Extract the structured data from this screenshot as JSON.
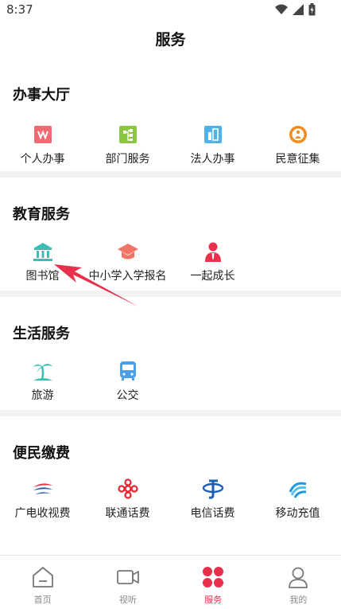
{
  "status": {
    "time": "8:37"
  },
  "page": {
    "title": "服务"
  },
  "sections": [
    {
      "title": "办事大厅",
      "items": [
        {
          "label": "个人办事",
          "icon": "person-service-icon"
        },
        {
          "label": "部门服务",
          "icon": "department-icon"
        },
        {
          "label": "法人办事",
          "icon": "legal-person-icon"
        },
        {
          "label": "民意征集",
          "icon": "public-opinion-icon"
        }
      ]
    },
    {
      "title": "教育服务",
      "items": [
        {
          "label": "图书馆",
          "icon": "library-icon"
        },
        {
          "label": "中小学入学报名",
          "icon": "graduation-cap-icon"
        },
        {
          "label": "一起成长",
          "icon": "grow-together-icon"
        }
      ]
    },
    {
      "title": "生活服务",
      "items": [
        {
          "label": "旅游",
          "icon": "palm-tree-icon"
        },
        {
          "label": "公交",
          "icon": "bus-icon"
        }
      ]
    },
    {
      "title": "便民缴费",
      "items": [
        {
          "label": "广电收视费",
          "icon": "broadcast-tv-icon"
        },
        {
          "label": "联通话费",
          "icon": "unicom-icon"
        },
        {
          "label": "电信话费",
          "icon": "telecom-icon"
        },
        {
          "label": "移动充值",
          "icon": "mobile-icon"
        }
      ]
    }
  ],
  "tabbar": [
    {
      "label": "首页",
      "icon": "home-icon",
      "active": false
    },
    {
      "label": "视听",
      "icon": "video-icon",
      "active": false
    },
    {
      "label": "服务",
      "icon": "services-grid-icon",
      "active": true
    },
    {
      "label": "我的",
      "icon": "profile-icon",
      "active": false
    }
  ],
  "colors": {
    "accent": "#e8304d",
    "annotation_arrow": "#e8304d",
    "divider": "#f2f2f2"
  }
}
